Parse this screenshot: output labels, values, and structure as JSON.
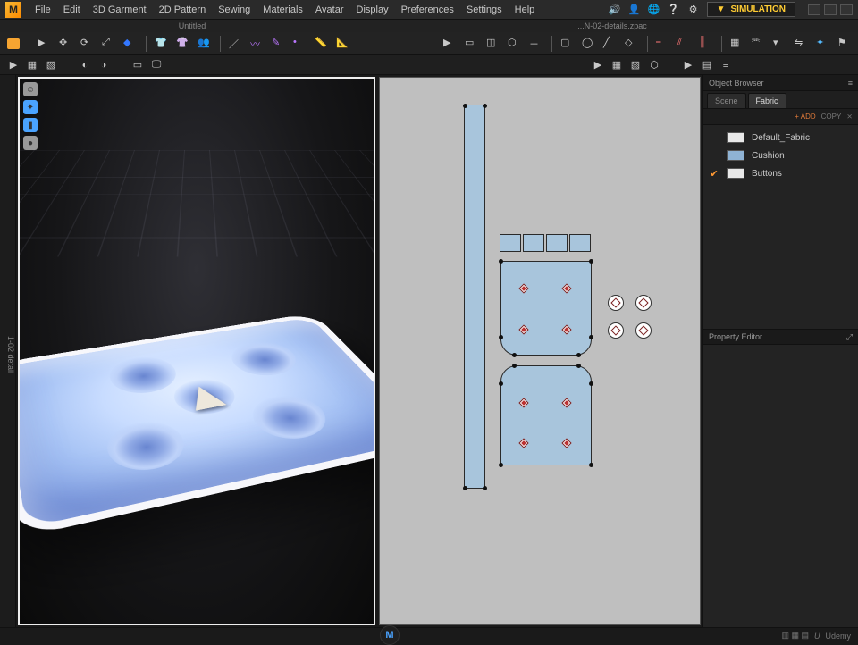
{
  "logo_letter": "M",
  "menu": [
    "File",
    "Edit",
    "3D Garment",
    "2D Pattern",
    "Sewing",
    "Materials",
    "Avatar",
    "Display",
    "Preferences",
    "Settings",
    "Help"
  ],
  "top_right_icons": [
    "speaker-icon",
    "user-icon",
    "globe-icon",
    "help-icon",
    "settings-icon"
  ],
  "simulation_label": "SIMULATION",
  "tab_left": "Untitled",
  "tab_right": "...N-02-details.zpac",
  "object_browser_title": "Object Browser",
  "panel_tabs": {
    "scene": "Scene",
    "fabric": "Fabric"
  },
  "panel_actions": {
    "add": "+ ADD",
    "copy": "COPY",
    "del": "⨯"
  },
  "fabrics": [
    {
      "checked": false,
      "swatch": "#e8e8e8",
      "label": "Default_Fabric"
    },
    {
      "checked": false,
      "swatch": "#8fb3d4",
      "label": "Cushion"
    },
    {
      "checked": true,
      "swatch": "#e8e8e8",
      "label": "Buttons"
    }
  ],
  "property_editor_title": "Property Editor",
  "status_right": "Udemy",
  "status_brand": "U",
  "side_label": "1-02 detail"
}
